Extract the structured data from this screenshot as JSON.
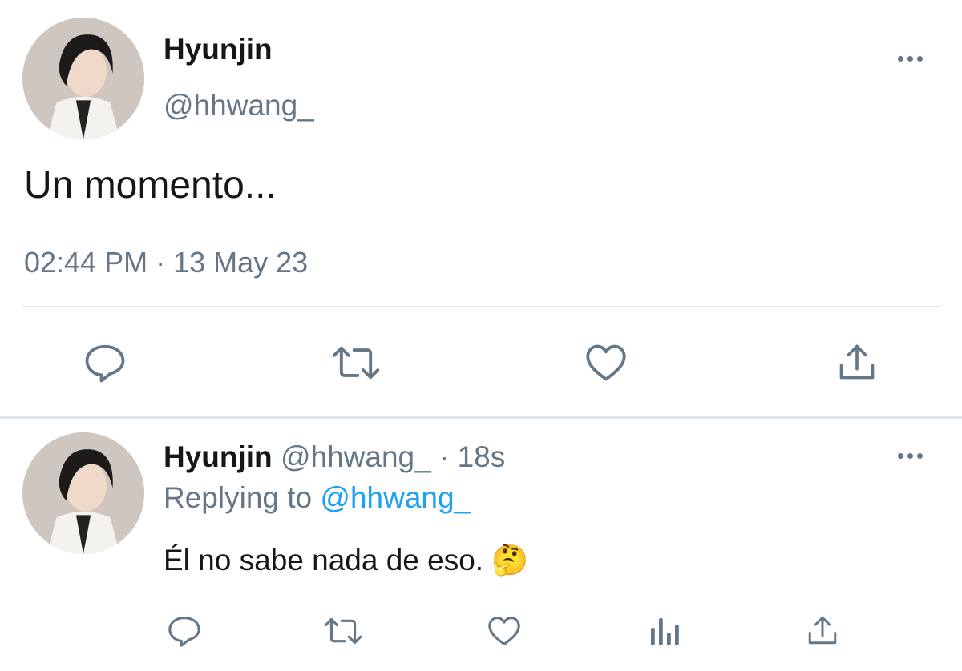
{
  "main_tweet": {
    "display_name": "Hyunjin",
    "handle": "@hhwang_",
    "text": "Un momento...",
    "timestamp": "02:44 PM · 13 May 23",
    "more_icon": "more-horizontal-icon",
    "actions": [
      {
        "icon": "reply-icon"
      },
      {
        "icon": "retweet-icon"
      },
      {
        "icon": "like-icon"
      },
      {
        "icon": "share-icon"
      }
    ]
  },
  "reply_tweet": {
    "display_name": "Hyunjin",
    "handle": "@hhwang_",
    "age": "· 18s",
    "replying_label": "Replying to",
    "replying_handle": "@hhwang_",
    "text": "Él no sabe nada de eso.",
    "emoji": "🤔",
    "more_icon": "more-horizontal-icon",
    "actions": [
      {
        "icon": "reply-icon"
      },
      {
        "icon": "retweet-icon"
      },
      {
        "icon": "like-icon"
      },
      {
        "icon": "analytics-icon"
      },
      {
        "icon": "share-icon"
      }
    ]
  },
  "colors": {
    "text": "#14171a",
    "muted": "#657786",
    "link": "#1da1f2",
    "divider": "#e1e8ed"
  }
}
